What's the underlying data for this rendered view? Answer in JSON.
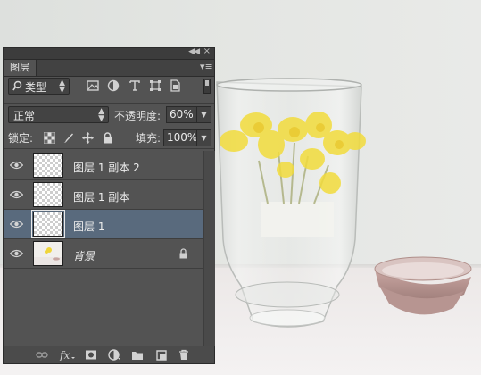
{
  "panel": {
    "tab": "图层",
    "filter": {
      "kind_label": "类型"
    },
    "blend_mode": "正常",
    "opacity_label": "不透明度:",
    "opacity_value": "60%",
    "lock_label": "锁定:",
    "fill_label": "填充:",
    "fill_value": "100%",
    "layers": [
      {
        "name": "图层 1 副本 2",
        "visible": true,
        "selected": false,
        "locked": false,
        "italic": false
      },
      {
        "name": "图层 1 副本",
        "visible": true,
        "selected": false,
        "locked": false,
        "italic": false
      },
      {
        "name": "图层 1",
        "visible": true,
        "selected": true,
        "locked": false,
        "italic": false
      },
      {
        "name": "背景",
        "visible": true,
        "selected": false,
        "locked": true,
        "italic": true
      }
    ],
    "bottom_icons": [
      "link-layers-icon",
      "fx-icon",
      "add-mask-icon",
      "adjustment-layer-icon",
      "new-group-icon",
      "new-layer-icon",
      "trash-icon"
    ]
  },
  "colors": {
    "panel_bg": "#535353",
    "selected_row": "#596a7d",
    "flower_yellow": "#f2dc3c"
  }
}
